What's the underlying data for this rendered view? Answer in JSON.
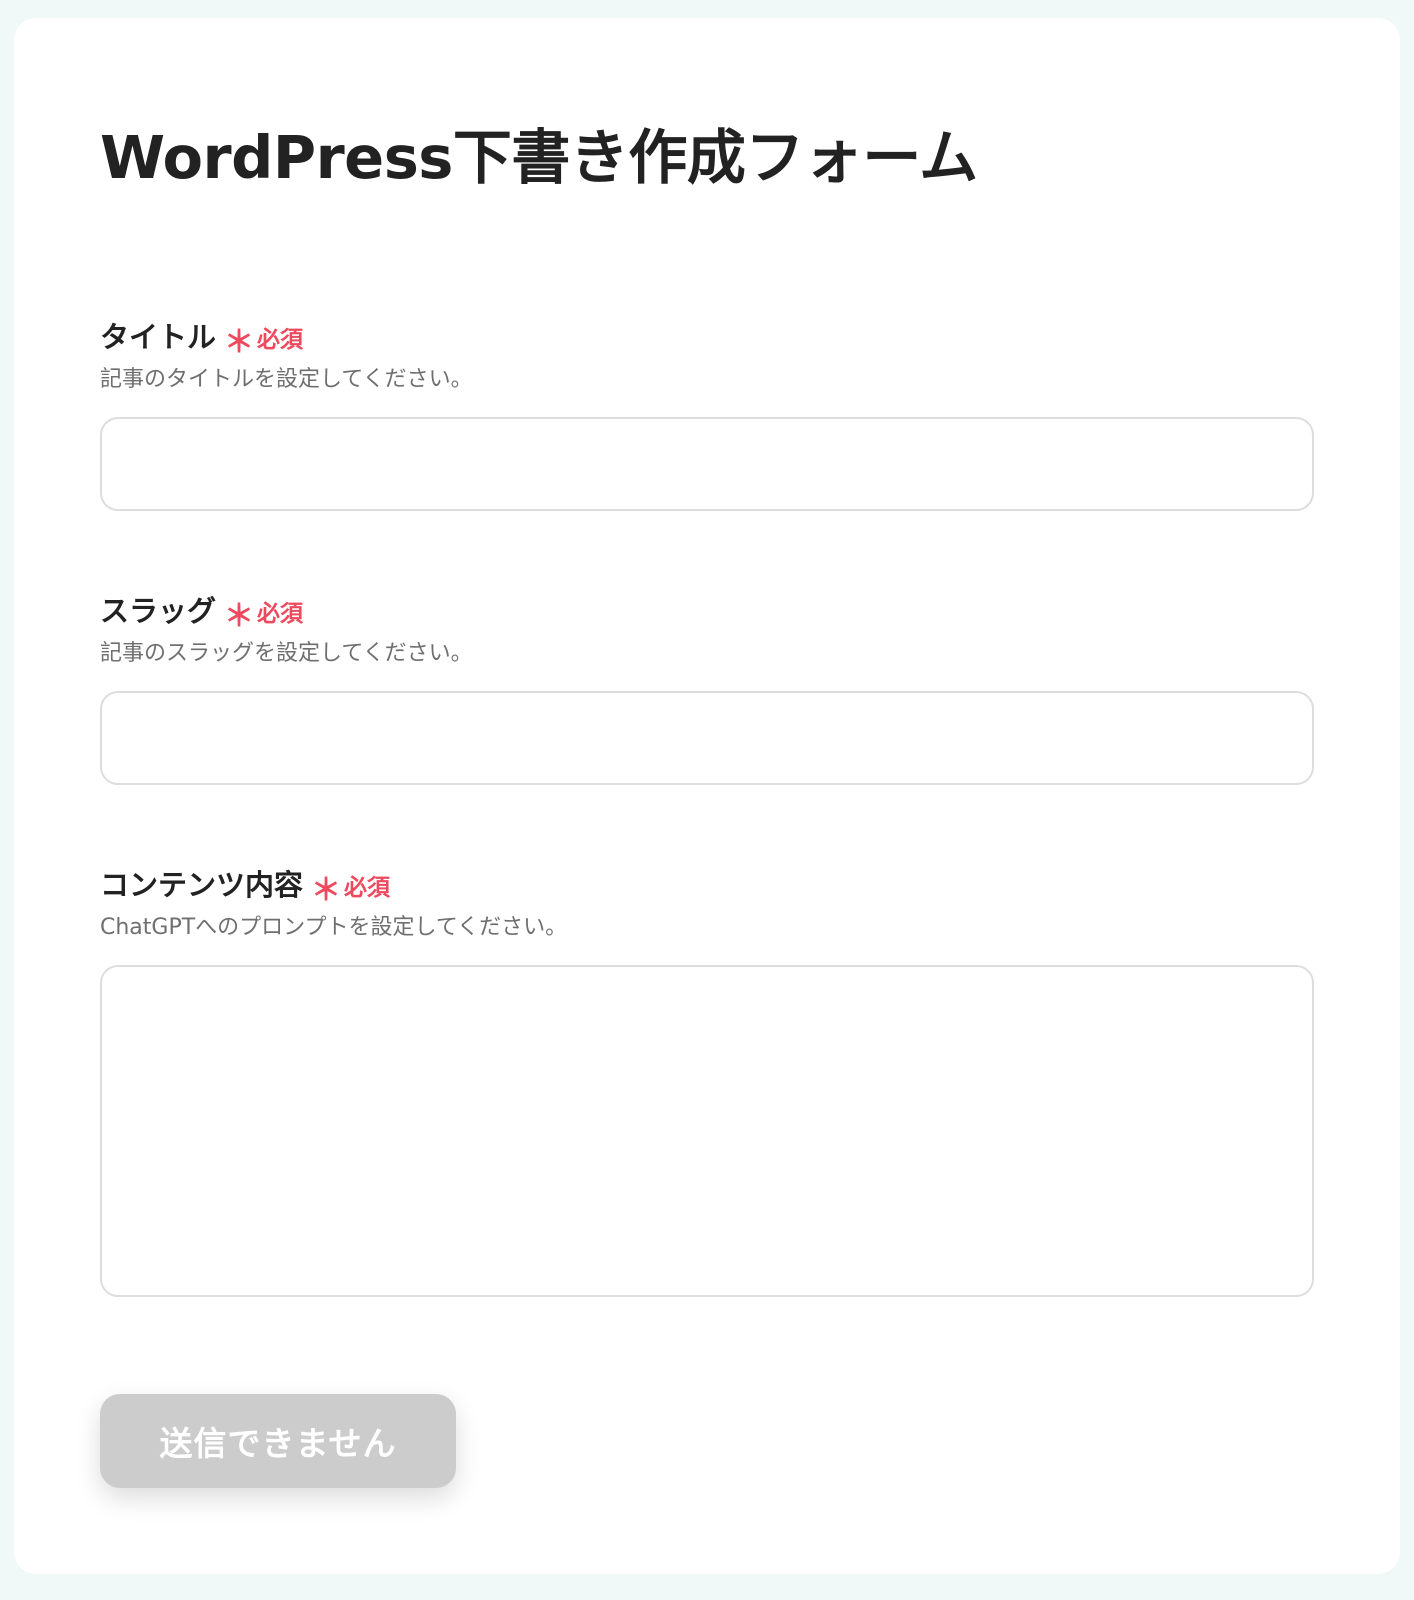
{
  "form": {
    "title": "WordPress下書き作成フォーム",
    "required_star": "＊",
    "required_text": "必須",
    "fields": [
      {
        "label": "タイトル",
        "description": "記事のタイトルを設定してください。",
        "value": ""
      },
      {
        "label": "スラッグ",
        "description": "記事のスラッグを設定してください。",
        "value": ""
      },
      {
        "label": "コンテンツ内容",
        "description": "ChatGPTへのプロンプトを設定してください。",
        "value": ""
      }
    ],
    "submit_label": "送信できません",
    "submit_disabled": true
  },
  "colors": {
    "page_background": "#f1f9f8",
    "card_background": "#ffffff",
    "required": "#ed4a5e",
    "button_disabled": "#cccccc",
    "input_border": "#dddddd"
  }
}
